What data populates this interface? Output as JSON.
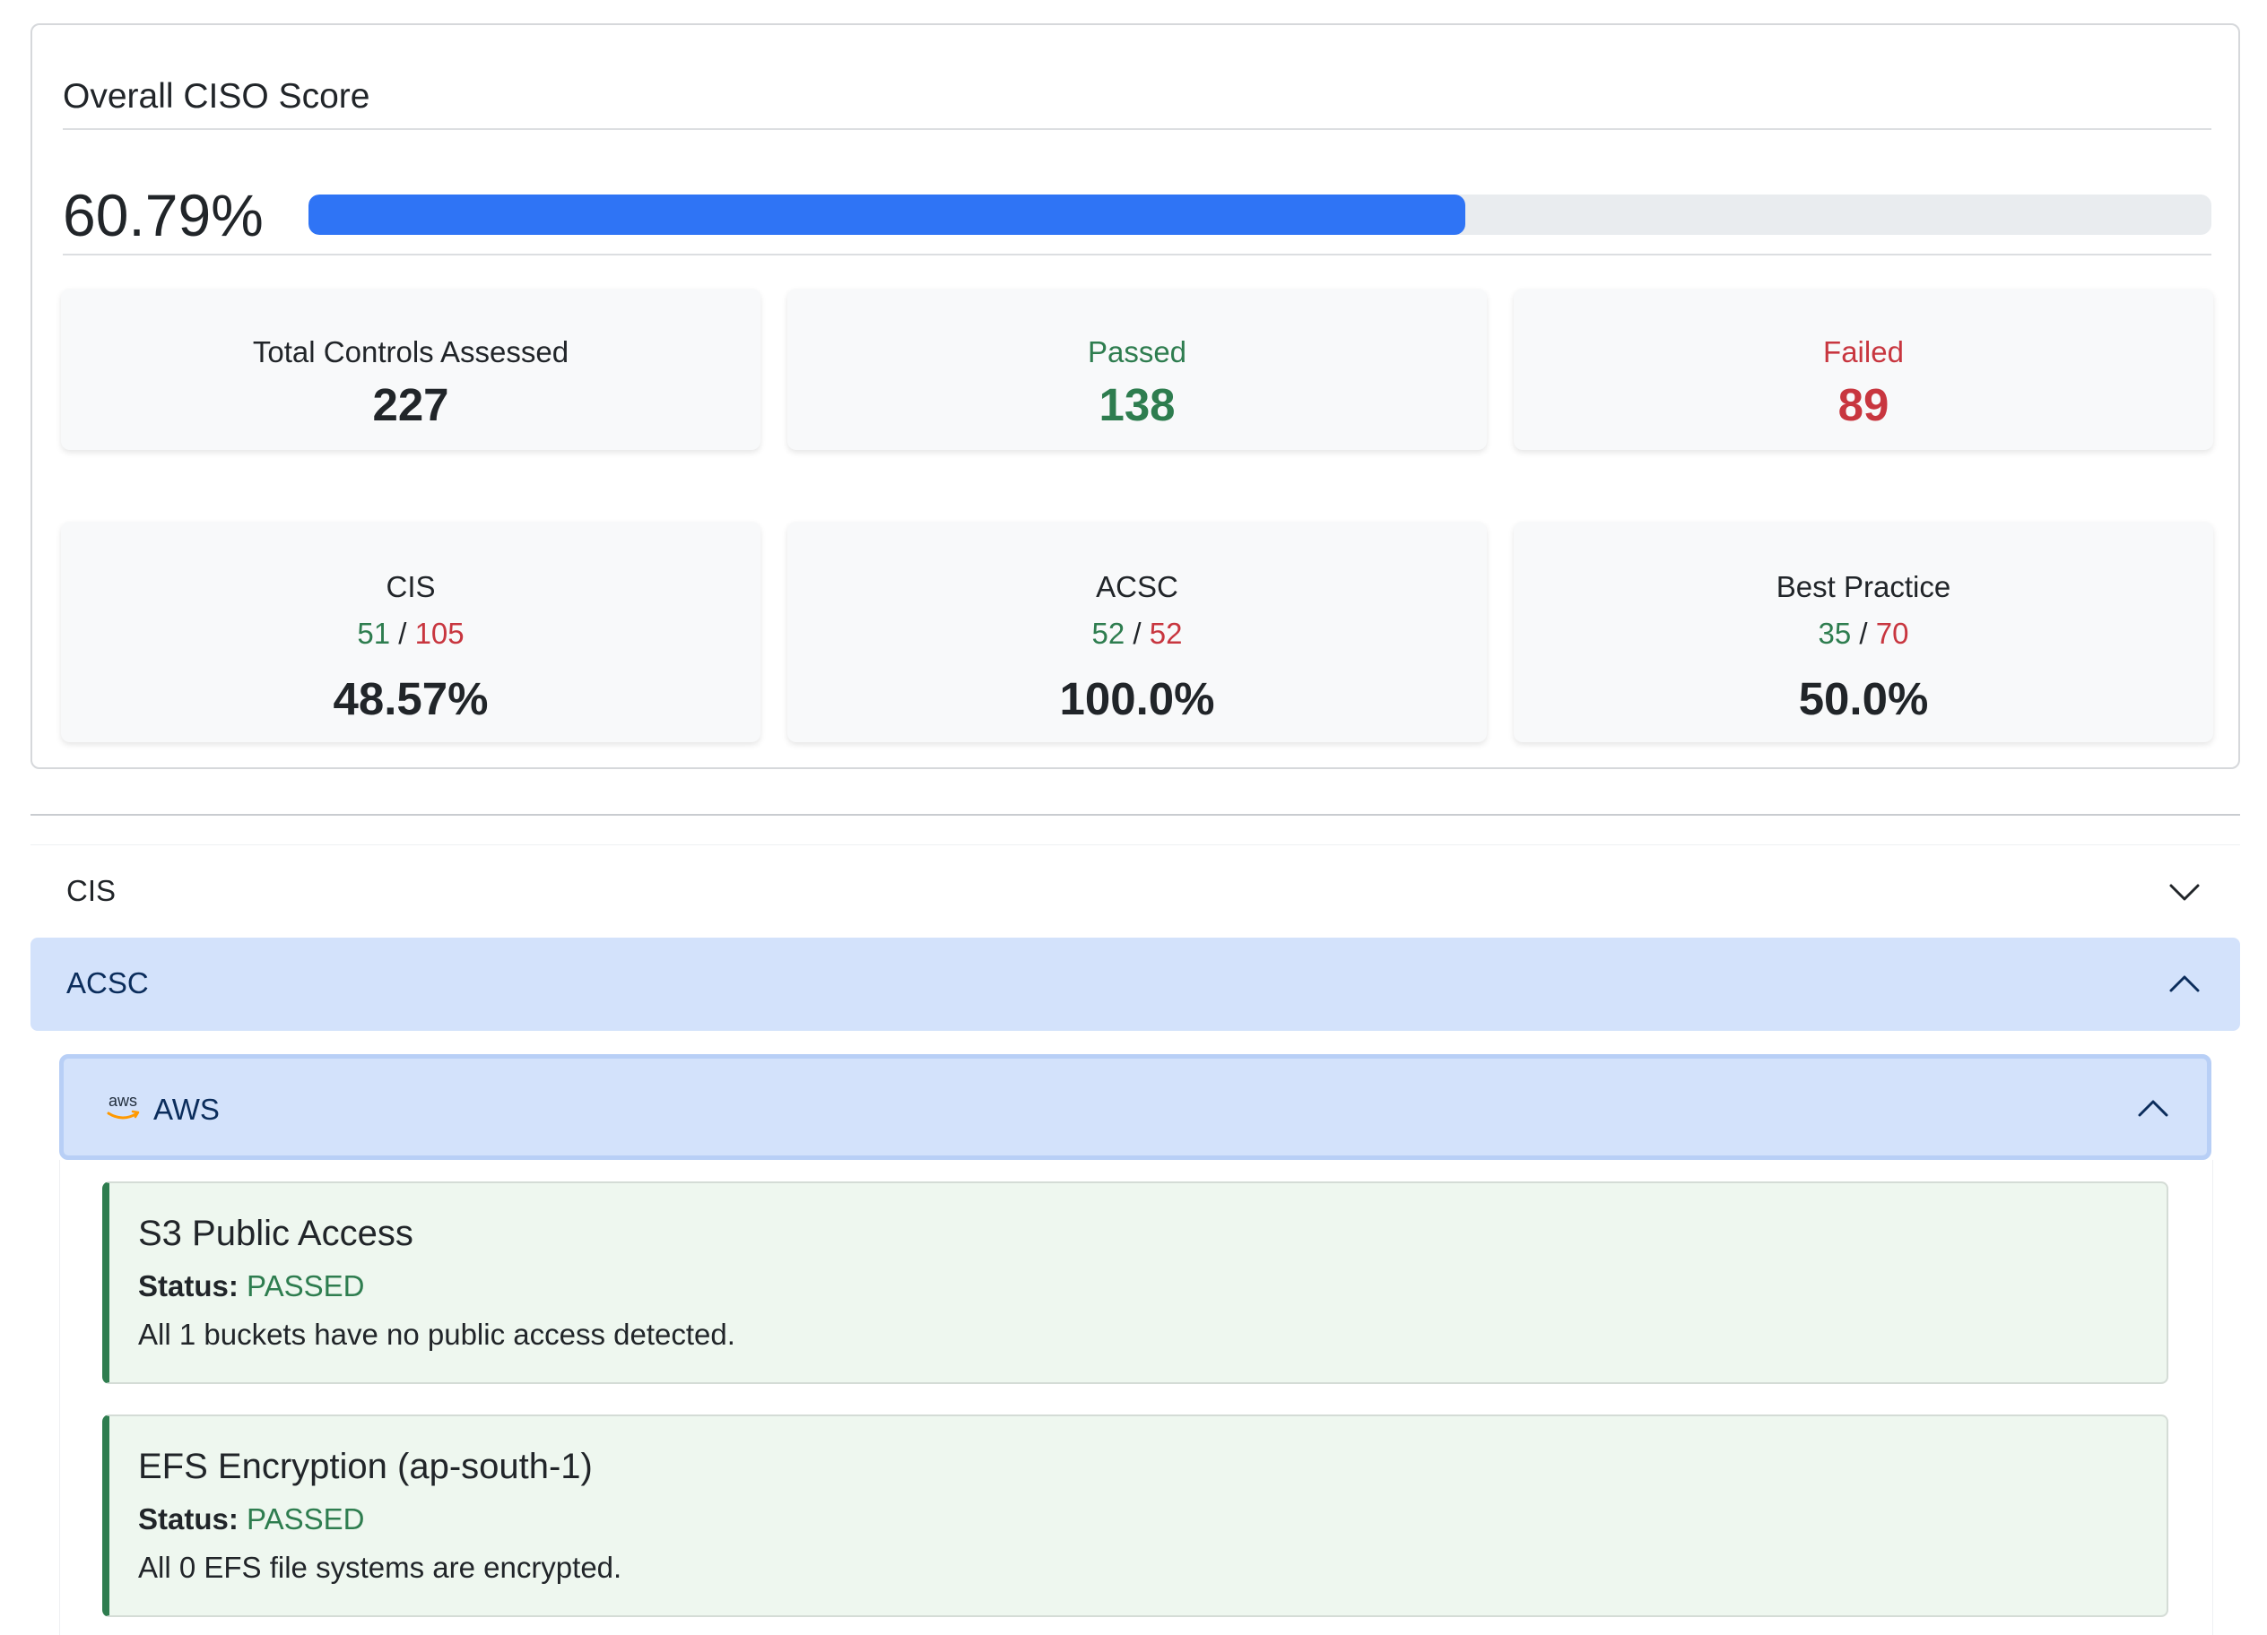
{
  "score_card": {
    "title": "Overall CISO Score",
    "score_text": "60.79%",
    "score_fraction": 0.6079,
    "totals": [
      {
        "label": "Total Controls Assessed",
        "value": "227",
        "tone": "dark"
      },
      {
        "label": "Passed",
        "value": "138",
        "tone": "green"
      },
      {
        "label": "Failed",
        "value": "89",
        "tone": "red"
      }
    ],
    "frameworks": [
      {
        "name": "CIS",
        "passed": "51",
        "separator": "/",
        "total": "105",
        "percent": "48.57%"
      },
      {
        "name": "ACSC",
        "passed": "52",
        "separator": "/",
        "total": "52",
        "percent": "100.0%"
      },
      {
        "name": "Best Practice",
        "passed": "35",
        "separator": "/",
        "total": "70",
        "percent": "50.0%"
      }
    ]
  },
  "accordion": {
    "sections": [
      {
        "label": "CIS",
        "expanded": false,
        "chevron": "chevron-down-icon"
      },
      {
        "label": "ACSC",
        "expanded": true,
        "chevron": "chevron-up-icon"
      }
    ],
    "provider": {
      "label": "AWS",
      "logo_text": "aws",
      "icon": "aws-logo-icon",
      "expanded": true
    },
    "checks": [
      {
        "title": "S3 Public Access",
        "status_label": "Status:",
        "status": "PASSED",
        "description": "All 1 buckets have no public access detected."
      },
      {
        "title": "EFS Encryption (ap-south-1)",
        "status_label": "Status:",
        "status": "PASSED",
        "description": "All 0 EFS file systems are encrypted."
      }
    ]
  },
  "colors": {
    "progress": "#2f74f5",
    "passed": "#2e7d4f",
    "failed": "#c8363f",
    "accordion_active": "#d3e2fb",
    "aws_orange": "#ff9900"
  }
}
